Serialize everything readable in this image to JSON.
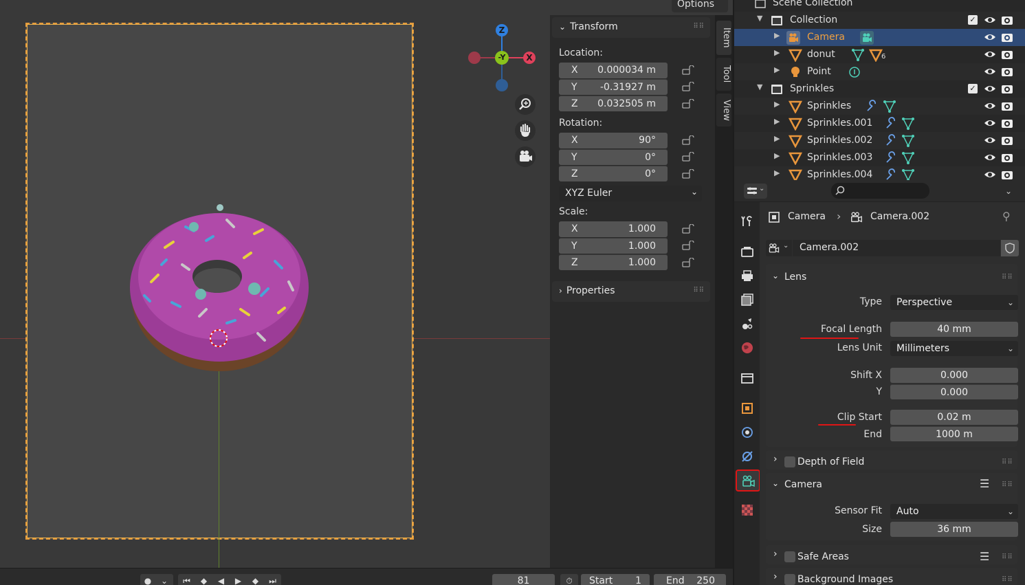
{
  "viewport": {
    "options_label": "Options",
    "gizmo": {
      "z_label": "Z",
      "y_label": "-Y",
      "x_label": "X"
    },
    "nav": {
      "zoom_icon": "zoom-icon",
      "pan_icon": "hand-icon",
      "camera_icon": "camera-icon"
    }
  },
  "npanel": {
    "tabs": [
      "Item",
      "Tool",
      "View"
    ],
    "transform_title": "Transform",
    "location_label": "Location:",
    "location": [
      {
        "axis": "X",
        "value": "0.000034 m"
      },
      {
        "axis": "Y",
        "value": "-0.31927 m"
      },
      {
        "axis": "Z",
        "value": "0.032505 m"
      }
    ],
    "rotation_label": "Rotation:",
    "rotation": [
      {
        "axis": "X",
        "value": "90°"
      },
      {
        "axis": "Y",
        "value": "0°"
      },
      {
        "axis": "Z",
        "value": "0°"
      }
    ],
    "rotation_mode": "XYZ Euler",
    "scale_label": "Scale:",
    "scale": [
      {
        "axis": "X",
        "value": "1.000"
      },
      {
        "axis": "Y",
        "value": "1.000"
      },
      {
        "axis": "Z",
        "value": "1.000"
      }
    ],
    "properties_title": "Properties"
  },
  "outliner": {
    "scene_collection": "Scene Collection",
    "rows": [
      {
        "name": "Collection",
        "type": "collection"
      },
      {
        "name": "Camera",
        "type": "camera",
        "selected": true
      },
      {
        "name": "donut",
        "type": "mesh",
        "modifier_count": "6"
      },
      {
        "name": "Point",
        "type": "light"
      },
      {
        "name": "Sprinkles",
        "type": "collection"
      },
      {
        "name": "Sprinkles",
        "type": "mesh"
      },
      {
        "name": "Sprinkles.001",
        "type": "mesh"
      },
      {
        "name": "Sprinkles.002",
        "type": "mesh"
      },
      {
        "name": "Sprinkles.003",
        "type": "mesh"
      },
      {
        "name": "Sprinkles.004",
        "type": "mesh"
      }
    ]
  },
  "properties": {
    "breadcrumb": {
      "object": "Camera",
      "data": "Camera.002"
    },
    "datablock_name": "Camera.002",
    "lens": {
      "title": "Lens",
      "type_label": "Type",
      "type_value": "Perspective",
      "focal_length_label": "Focal Length",
      "focal_length_value": "40 mm",
      "lens_unit_label": "Lens Unit",
      "lens_unit_value": "Millimeters",
      "shift_x_label": "Shift X",
      "shift_x_value": "0.000",
      "shift_y_label": "Y",
      "shift_y_value": "0.000",
      "clip_start_label": "Clip Start",
      "clip_start_value": "0.02 m",
      "clip_end_label": "End",
      "clip_end_value": "1000 m"
    },
    "dof_title": "Depth of Field",
    "camera": {
      "title": "Camera",
      "sensor_fit_label": "Sensor Fit",
      "sensor_fit_value": "Auto",
      "size_label": "Size",
      "size_value": "36 mm"
    },
    "safe_areas_title": "Safe Areas",
    "background_images_title": "Background Images"
  },
  "timeline": {
    "current_frame": "81",
    "start_label": "Start",
    "start_value": "1",
    "end_label": "End",
    "end_value": "250"
  },
  "colors": {
    "selection": "#2f4b78",
    "accent_orange": "#e49b3c",
    "highlight_red": "#e01515",
    "axis_x": "#e0415b",
    "axis_y": "#8ac31c",
    "axis_z": "#2f80e0"
  }
}
